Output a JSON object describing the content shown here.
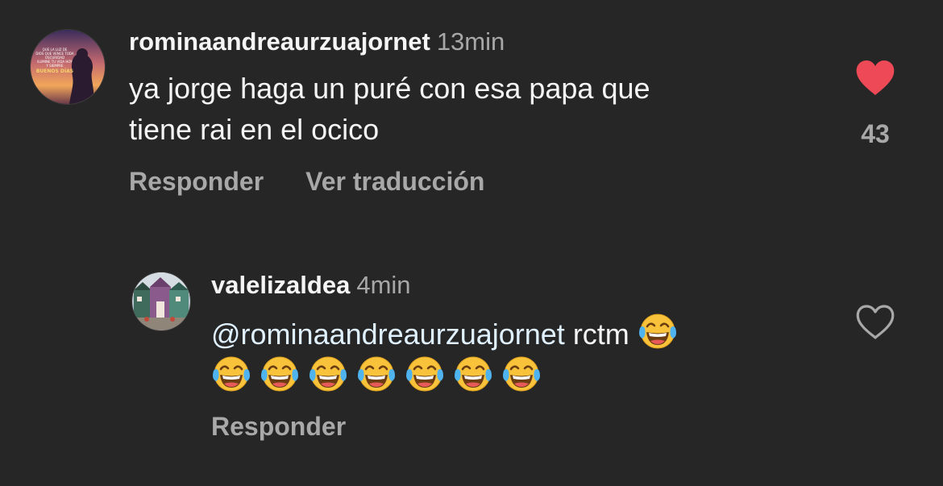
{
  "comments": [
    {
      "username": "rominaandreaurzuajornet",
      "time": "13min",
      "text_line1": "ya jorge haga un puré con esa papa que",
      "text_line2": "tiene rai en el ocico",
      "reply_label": "Responder",
      "translate_label": "Ver traducción",
      "liked": true,
      "like_count": "43",
      "avatar_text": [
        "QUE LA LUZ DE",
        "DIOS QUE VENCE TODA",
        "OSCURIDAD",
        "ILUMINE TU VIDA HOY",
        "Y SIEMPRE",
        "BUENOS DÍAS"
      ]
    },
    {
      "username": "valelizaldea",
      "time": "4min",
      "mention": "@rominaandreaurzuajornet",
      "text_after": "rctm",
      "emoji_count": 8,
      "emoji": "face-with-tears-of-joy",
      "reply_label": "Responder",
      "liked": false
    }
  ],
  "colors": {
    "background": "#262626",
    "text": "#f5f5f5",
    "secondary": "#a8a8a8",
    "like_red": "#ed4956",
    "mention": "#e0f1ff"
  }
}
